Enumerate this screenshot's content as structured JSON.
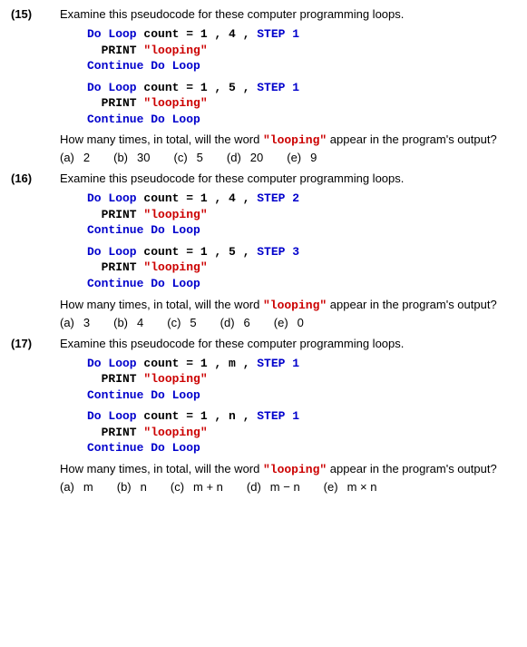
{
  "questions": [
    {
      "num": "(15)",
      "prompt": "Examine this pseudocode for these computer programming loops.",
      "code1_l1a": "Do Loop",
      "code1_l1b": " count = 1 , 4 , ",
      "code1_l1c": "STEP 1",
      "code1_l2a": "  PRINT ",
      "code1_l2b": "\"looping\"",
      "code1_l3": "Continue Do Loop",
      "code2_l1a": "Do Loop",
      "code2_l1b": " count = 1 , 5 , ",
      "code2_l1c": "STEP 1",
      "code2_l2a": "  PRINT ",
      "code2_l2b": "\"looping\"",
      "code2_l3": "Continue Do Loop",
      "follow_pre": "How many times, in total, will the word ",
      "follow_code": "\"looping\"",
      "follow_post": " appear in the program's output?",
      "opts": {
        "a_l": "(a)",
        "a_v": "2",
        "b_l": "(b)",
        "b_v": "30",
        "c_l": "(c)",
        "c_v": "5",
        "d_l": "(d)",
        "d_v": "20",
        "e_l": "(e)",
        "e_v": "9"
      }
    },
    {
      "num": "(16)",
      "prompt": "Examine this pseudocode for these computer programming loops.",
      "code1_l1a": "Do Loop",
      "code1_l1b": " count = 1 , 4 , ",
      "code1_l1c": "STEP 2",
      "code1_l2a": "  PRINT ",
      "code1_l2b": "\"looping\"",
      "code1_l3": "Continue Do Loop",
      "code2_l1a": "Do Loop",
      "code2_l1b": " count = 1 , 5 , ",
      "code2_l1c": "STEP 3",
      "code2_l2a": "  PRINT ",
      "code2_l2b": "\"looping\"",
      "code2_l3": "Continue Do Loop",
      "follow_pre": "How many times, in total, will the word ",
      "follow_code": "\"looping\"",
      "follow_post": " appear in the program's output?",
      "opts": {
        "a_l": "(a)",
        "a_v": "3",
        "b_l": "(b)",
        "b_v": "4",
        "c_l": "(c)",
        "c_v": "5",
        "d_l": "(d)",
        "d_v": "6",
        "e_l": "(e)",
        "e_v": "0"
      }
    },
    {
      "num": "(17)",
      "prompt": "Examine this pseudocode for these computer programming loops.",
      "code1_l1a": "Do Loop",
      "code1_l1b": " count = 1 , m , ",
      "code1_l1c": "STEP 1",
      "code1_l2a": "  PRINT ",
      "code1_l2b": "\"looping\"",
      "code1_l3": "Continue Do Loop",
      "code2_l1a": "Do Loop",
      "code2_l1b": " count = 1 , n , ",
      "code2_l1c": "STEP 1",
      "code2_l2a": "  PRINT ",
      "code2_l2b": "\"looping\"",
      "code2_l3": "Continue Do Loop",
      "follow_pre": "How many times, in total, will the word ",
      "follow_code": "\"looping\"",
      "follow_post": " appear in the program's output?",
      "opts": {
        "a_l": "(a)",
        "a_v": "m",
        "b_l": "(b)",
        "b_v": "n",
        "c_l": "(c)",
        "c_v": "m + n",
        "d_l": "(d)",
        "d_v": "m − n",
        "e_l": "(e)",
        "e_v": "m × n"
      }
    }
  ]
}
